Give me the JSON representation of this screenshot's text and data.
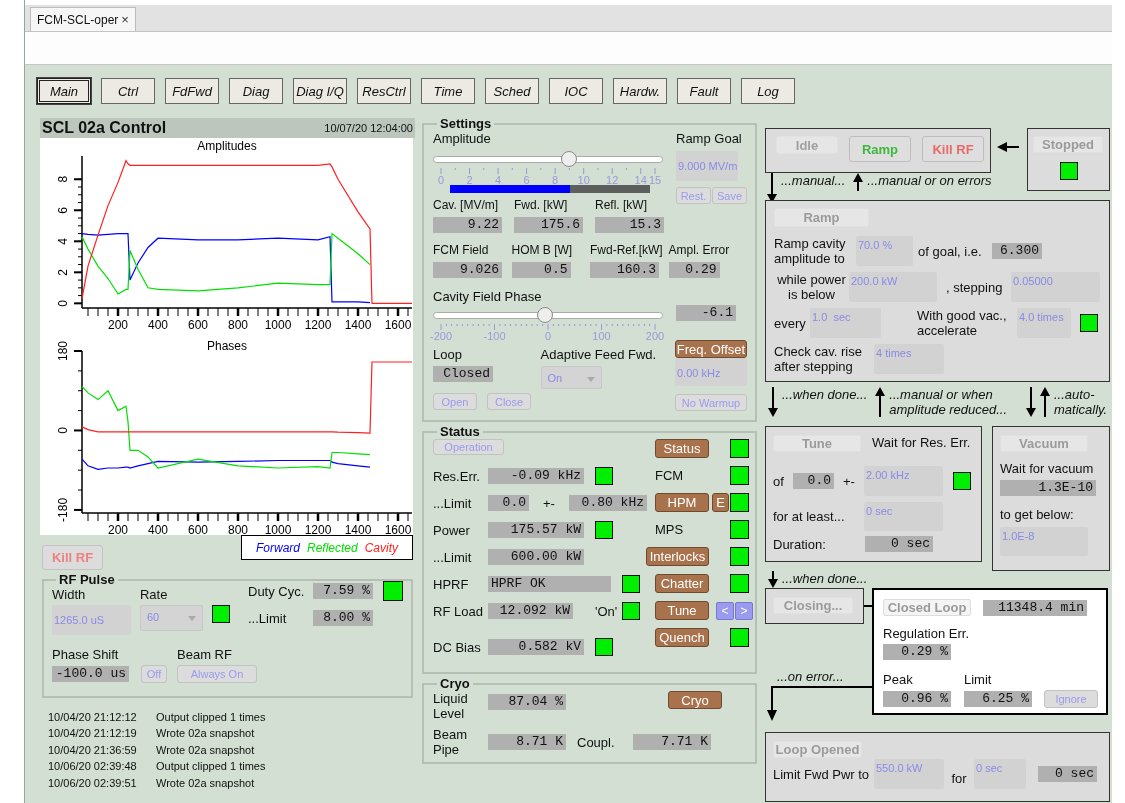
{
  "tab": {
    "label": "FCM-SCL-oper",
    "close": "×"
  },
  "nav": [
    {
      "label": "Main",
      "selected": true
    },
    {
      "label": "Ctrl",
      "selected": false
    },
    {
      "label": "FdFwd",
      "selected": false
    },
    {
      "label": "Diag",
      "selected": false
    },
    {
      "label": "Diag I/Q",
      "selected": false
    },
    {
      "label": "ResCtrl",
      "selected": false
    },
    {
      "label": "Time",
      "selected": false
    },
    {
      "label": "Sched",
      "selected": false
    },
    {
      "label": "IOC",
      "selected": false
    },
    {
      "label": "Hardw.",
      "selected": false
    },
    {
      "label": "Fault",
      "selected": false
    },
    {
      "label": "Log",
      "selected": false
    }
  ],
  "control": {
    "title": "SCL 02a Control",
    "timestamp": "10/07/20 12:04:00",
    "charts": [
      {
        "chart_data": {
          "type": "line",
          "title": "Amplitudes",
          "x": [
            20,
            50,
            100,
            150,
            200,
            240,
            250,
            260,
            300,
            350,
            400,
            600,
            800,
            1000,
            1200,
            1260,
            1270,
            1300,
            1400,
            1460,
            1470,
            1670
          ],
          "xlim": [
            20,
            1670
          ],
          "ylim": [
            -0.3,
            9.5
          ],
          "xticks": [
            200,
            400,
            600,
            800,
            1000,
            1200,
            1400,
            1600
          ],
          "yticks": [
            0,
            2,
            4,
            6,
            8
          ],
          "series": [
            {
              "name": "Forward",
              "color": "#0000ff",
              "values": [
                4.5,
                4.45,
                4.4,
                4.45,
                4.5,
                4.5,
                4.5,
                1.5,
                2.6,
                3.6,
                4.2,
                4.1,
                4.1,
                4.2,
                4.1,
                4.3,
                0.1,
                0.1,
                0.1,
                0.05,
                null,
                null
              ]
            },
            {
              "name": "Reflected",
              "color": "#00e000",
              "values": [
                4.3,
                3.5,
                2.4,
                1.6,
                0.6,
                0.9,
                0.9,
                3.4,
                2.2,
                1.0,
                0.9,
                0.8,
                1.0,
                1.3,
                1.2,
                1.2,
                4.5,
                4.2,
                3.2,
                2.5,
                null,
                null
              ]
            },
            {
              "name": "Cavity",
              "color": "#ff2020",
              "values": [
                0.3,
                2.4,
                4.4,
                6.3,
                7.8,
                9.2,
                9.0,
                8.9,
                8.9,
                8.9,
                8.9,
                8.9,
                8.9,
                8.9,
                8.9,
                9.0,
                8.8,
                8.0,
                5.9,
                4.8,
                0,
                0
              ]
            }
          ]
        }
      },
      {
        "chart_data": {
          "type": "line",
          "title": "Phases",
          "x": [
            20,
            50,
            100,
            150,
            200,
            240,
            250,
            260,
            300,
            350,
            400,
            600,
            800,
            1000,
            1200,
            1260,
            1270,
            1300,
            1400,
            1460,
            1470,
            1670
          ],
          "xlim": [
            20,
            1670
          ],
          "ylim": [
            -187,
            180
          ],
          "xticks": [
            200,
            400,
            600,
            800,
            1000,
            1200,
            1400,
            1600
          ],
          "yticks": [
            -180,
            0,
            180
          ],
          "series": [
            {
              "color": "#0000ff",
              "values": [
                -65,
                -80,
                -88,
                -85,
                -85,
                -83,
                -83,
                -85,
                -80,
                -75,
                -70,
                -72,
                -70,
                -68,
                -68,
                -68,
                -72,
                -75,
                -80,
                -83,
                null,
                null
              ]
            },
            {
              "color": "#00e000",
              "values": [
                100,
                85,
                70,
                90,
                45,
                55,
                20,
                -45,
                -45,
                -60,
                -85,
                -65,
                -80,
                -85,
                -82,
                -85,
                -50,
                -50,
                -53,
                -55,
                null,
                null
              ]
            },
            {
              "color": "#ff2020",
              "values": [
                8,
                2,
                -3,
                -3,
                -3,
                -3,
                -3,
                -3,
                -3,
                -3,
                -3,
                -3,
                -3,
                -3,
                -3,
                -3,
                -3,
                -4,
                -5,
                -6,
                155,
                155
              ]
            }
          ]
        }
      }
    ],
    "kill_rf": "Kill RF"
  },
  "rf_pulse": {
    "title": "RF Pulse",
    "width": {
      "label": "Width",
      "value": "1265.0 uS"
    },
    "rate": {
      "label": "Rate",
      "value": "60",
      "ok": true
    },
    "duty": {
      "label": "Duty Cyc.",
      "value": "7.59 %",
      "ok": true
    },
    "duty_limit": {
      "label": "...Limit",
      "value": "8.00 %"
    },
    "phase_shift": {
      "label": "Phase Shift",
      "value": "-100.0 us",
      "button": "Off"
    },
    "beam_rf": {
      "label": "Beam RF",
      "button": "Always On"
    }
  },
  "log": [
    {
      "time": "10/04/20 21:12:12",
      "message": "Output clipped 1 times"
    },
    {
      "time": "10/04/20 21:12:19",
      "message": "Wrote 02a snapshot"
    },
    {
      "time": "10/04/20 21:36:59",
      "message": "Wrote 02a snapshot"
    },
    {
      "time": "10/06/20 02:39:48",
      "message": "Output clipped 1 times"
    },
    {
      "time": "10/06/20 02:39:51",
      "message": "Wrote 02a snapshot"
    }
  ],
  "settings": {
    "title": "Settings",
    "amplitude": {
      "label": "Amplitude",
      "level": 0.6,
      "ticks": [
        "0",
        "2",
        "4",
        "6",
        "8",
        "10",
        "12",
        "14",
        "15"
      ],
      "bar": {
        "level": 0.6
      }
    },
    "ramp_goal": {
      "label": "Ramp Goal",
      "value": "9.000 MV/m",
      "buttons": [
        "Rest.",
        "Save"
      ]
    },
    "readings": [
      [
        {
          "label": "Cav. [MV/m]",
          "value": "9.22"
        },
        {
          "label": "Fwd. [kW]",
          "value": "175.6"
        },
        {
          "label": "Refl. [kW]",
          "value": "15.3"
        }
      ],
      [
        {
          "label": "FCM Field",
          "value": "9.026"
        },
        {
          "label": "HOM B [W]",
          "value": "0.5"
        },
        {
          "label": "Fwd-Ref.[kW]",
          "value": "160.3"
        },
        {
          "label": "Ampl. Error",
          "value": "0.29"
        }
      ]
    ],
    "phase": {
      "label": "Cavity Field Phase",
      "level": 0.485,
      "ticks": [
        "-200",
        "-100",
        "0",
        "100",
        "200"
      ],
      "value": "-6.1"
    },
    "loop": {
      "label": "Loop",
      "value": "Closed",
      "buttons": [
        "Open",
        "Close"
      ]
    },
    "adaptive": {
      "label": "Adaptive Feed Fwd.",
      "value": "On"
    },
    "freq_offset": {
      "button": "Freq. Offset",
      "value": "0.00 kHz",
      "warmup": "No Warmup"
    }
  },
  "status": {
    "title": "Status",
    "mode": "Operation",
    "left": [
      {
        "kind": "number",
        "label": "Res.Err.",
        "fields": [
          "-0.09 kHz"
        ],
        "ok": true
      },
      {
        "kind": "range",
        "label": "...Limit",
        "fields": [
          "0.0",
          "0.80 kHz"
        ],
        "separator": "+-"
      },
      {
        "kind": "number",
        "label": "Power",
        "fields": [
          "175.57 kW"
        ],
        "ok": true
      },
      {
        "kind": "number",
        "label": "...Limit",
        "fields": [
          "600.00 kW"
        ]
      },
      {
        "kind": "text",
        "label": "HPRF",
        "fields": [
          "HPRF OK"
        ],
        "ok": true
      },
      {
        "kind": "number",
        "label": "RF Load",
        "fields": [
          "12.092 kW"
        ],
        "note": "'On'",
        "ok": true
      },
      {
        "kind": "number",
        "label": "DC Bias",
        "fields": [
          "0.582 kV"
        ],
        "ok": true
      }
    ],
    "right": [
      {
        "kind": "button",
        "label": "Status",
        "ok": true
      },
      {
        "kind": "label",
        "label": "FCM",
        "ok": true
      },
      {
        "kind": "button",
        "label": "HPM",
        "extra": "E",
        "ok": true
      },
      {
        "kind": "label",
        "label": "MPS",
        "ok": true
      },
      {
        "kind": "button",
        "label": "Interlocks",
        "ok": true
      },
      {
        "kind": "button",
        "label": "Chatter",
        "ok": true
      },
      {
        "kind": "button",
        "label": "Tune",
        "arrows": [
          "<",
          ">"
        ]
      },
      {
        "kind": "button",
        "label": "Quench",
        "ok": true
      }
    ]
  },
  "cryo": {
    "title": "Cryo",
    "button": "Cryo",
    "rows": [
      {
        "label": "Liquid Level",
        "value": "87.04 %"
      },
      {
        "label": "Beam Pipe",
        "value": "8.71 K",
        "extra_label": "Coupl.",
        "extra_value": "7.71 K"
      }
    ]
  },
  "sequence": {
    "idle": [
      {
        "label": "Idle",
        "kind": "state",
        "color": "#a0a0a0"
      },
      {
        "label": "Ramp",
        "kind": "action",
        "color": "#3cb83c"
      },
      {
        "label": "Kill RF",
        "kind": "action",
        "color": "#ea6a6a"
      }
    ],
    "stopped": {
      "label": "Stopped",
      "ok": true
    },
    "transitions_top": [
      {
        "arrows": [
          {
            "kind": "down"
          }
        ],
        "text": "...manual..."
      },
      {
        "arrows": [
          {
            "kind": "up"
          }
        ],
        "text": "...manual or on errors"
      }
    ],
    "ramp": {
      "header": "Ramp",
      "goal_label": "Ramp cavity amplitude to",
      "goal": "70.0 %",
      "goal_suffix": "of goal, i.e.",
      "goal_value": "6.300",
      "power_label": "while power is below",
      "power": "200.0 kW",
      "step_label": ", stepping",
      "step": "0.05000",
      "every_label": "every",
      "every": "1.0  sec",
      "vac_label": "With good vac., accelerate",
      "vac": "4.0 times",
      "vac_ok": true,
      "check_label": "Check cav. rise after stepping",
      "check": "4 times"
    },
    "transitions_mid": [
      {
        "arrows": [
          {
            "kind": "down"
          }
        ],
        "text": "...when done..."
      },
      {
        "arrows": [
          {
            "kind": "up"
          }
        ],
        "text": "...manual or when amplitude reduced..."
      },
      {
        "arrows": [
          {
            "kind": "down"
          },
          {
            "kind": "up"
          }
        ],
        "text": "...auto-matically."
      }
    ],
    "tune": {
      "header": "Tune",
      "wait_label": "Wait for Res. Err.",
      "of_label": "of",
      "of_value": "0.0",
      "separator": "+-",
      "tolerance": "2.00 kHz",
      "ok": true,
      "least_label": "for at least...",
      "least": "0 sec",
      "duration_label": "Duration:",
      "duration": "0 sec"
    },
    "vacuum": {
      "header": "Vacuum",
      "wait_label": "Wait for vacuum",
      "value": "1.3E-10",
      "below_label": "to get below:",
      "below": "1.0E-8"
    },
    "after_tune": {
      "arrows": [
        {
          "kind": "down"
        }
      ],
      "text": "...when done..."
    },
    "closing": {
      "header": "Closing..."
    },
    "closed_loop": {
      "header": "Closed Loop",
      "time": "11348.4 min",
      "reg_label": "Regulation Err.",
      "reg": "0.29 %",
      "peak_label": "Peak",
      "peak": "0.96 %",
      "limit_label": "Limit",
      "limit": "6.25 %",
      "button": "Ignore"
    },
    "on_error": "...on error...",
    "loop_opened": {
      "header": "Loop Opened",
      "limit_label": "Limit Fwd Pwr to",
      "limit": "550.0 kW",
      "for_label": "for",
      "for": "0 sec",
      "elapsed": "0 sec"
    }
  }
}
